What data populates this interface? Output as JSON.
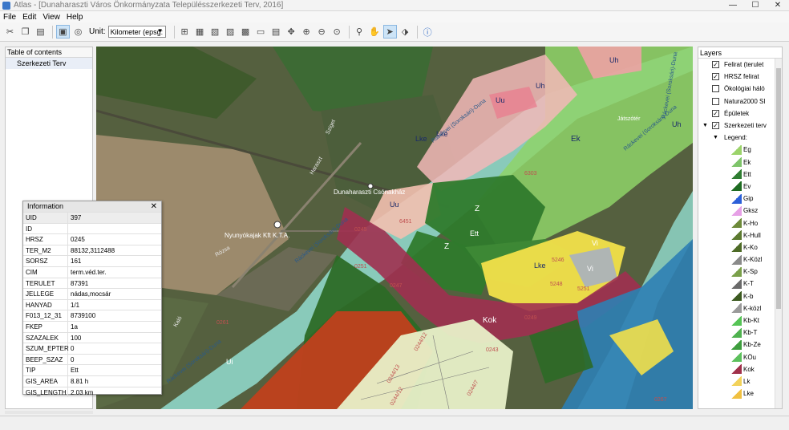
{
  "window": {
    "title": "Atlas - [Dunaharaszti Város Önkormányzata Településszerkezeti Terv, 2016]",
    "minimize": "—",
    "maximize": "☐",
    "close": "✕"
  },
  "menu": [
    "File",
    "Edit",
    "View",
    "Help"
  ],
  "toolbar": {
    "unit_label": "Unit:",
    "unit_value": "Kilometer (epsg:"
  },
  "toc": {
    "header": "Table of contents",
    "items": [
      "Szerkezeti Terv"
    ]
  },
  "layers": {
    "header": "Layers",
    "items": [
      {
        "label": "Felirat (terulet",
        "checked": true
      },
      {
        "label": "HRSZ felirat",
        "checked": true
      },
      {
        "label": "Ökológiai háló",
        "checked": false
      },
      {
        "label": "Natura2000 SI",
        "checked": false
      },
      {
        "label": "Épületek",
        "checked": true
      },
      {
        "label": "Szerkezeti terv",
        "checked": true
      }
    ],
    "legend_label": "Legend:",
    "legend": [
      {
        "label": "Eg",
        "color": "#9bd36a"
      },
      {
        "label": "Ek",
        "color": "#7ec46a"
      },
      {
        "label": "Ett",
        "color": "#2f7d32"
      },
      {
        "label": "Ev",
        "color": "#1e6b21"
      },
      {
        "label": "Gip",
        "color": "#2b5fd8"
      },
      {
        "label": "Gksz",
        "color": "#e6a0e6"
      },
      {
        "label": "K-Ho",
        "color": "#6d8a3a"
      },
      {
        "label": "K-Hull",
        "color": "#5c7a30"
      },
      {
        "label": "K-Ko",
        "color": "#4e6b27"
      },
      {
        "label": "K-Közl",
        "color": "#8a8a8a"
      },
      {
        "label": "K-Sp",
        "color": "#7aa04a"
      },
      {
        "label": "K-T",
        "color": "#6a6a6a"
      },
      {
        "label": "K-b",
        "color": "#3c5a20"
      },
      {
        "label": "K-közl",
        "color": "#9a9a9a"
      },
      {
        "label": "Kb-Kt",
        "color": "#55c455"
      },
      {
        "label": "Kb-T",
        "color": "#4fb24f"
      },
      {
        "label": "Kb-Ze",
        "color": "#3e9e3e"
      },
      {
        "label": "KÖu",
        "color": "#5cc05c"
      },
      {
        "label": "Kok",
        "color": "#a0304a"
      },
      {
        "label": "Lk",
        "color": "#f2d25a"
      },
      {
        "label": "Lke",
        "color": "#f0c040"
      }
    ]
  },
  "info": {
    "title": "Information",
    "close": "✕",
    "rows": [
      {
        "key": "UID",
        "value": "397"
      },
      {
        "key": "ID",
        "value": ""
      },
      {
        "key": "HRSZ",
        "value": "0245"
      },
      {
        "key": "TER_M2",
        "value": "88132,3112488"
      },
      {
        "key": "SORSZ",
        "value": "161"
      },
      {
        "key": "CIM",
        "value": "term.véd.ter."
      },
      {
        "key": "TERULET",
        "value": "87391"
      },
      {
        "key": "JELLEGE",
        "value": "nádas,mocsár"
      },
      {
        "key": "HANYAD",
        "value": "1/1"
      },
      {
        "key": "F013_12_31",
        "value": "8739100"
      },
      {
        "key": "FKEP",
        "value": "1a"
      },
      {
        "key": "SZAZALEK",
        "value": "100"
      },
      {
        "key": "SZUM_EPTER",
        "value": "0"
      },
      {
        "key": "BEEP_SZAZ",
        "value": "0"
      },
      {
        "key": "TIP",
        "value": "Ett"
      },
      {
        "key": "GIS_AREA",
        "value": "8.81 h"
      },
      {
        "key": "GIS_LENGTH",
        "value": "2.03 km"
      }
    ]
  },
  "map": {
    "labels": {
      "ek": "Ek",
      "z1": "Z",
      "z2": "Z",
      "ett": "Ett",
      "lke1": "Lke",
      "lke2": "Lke",
      "lke3": "Lke",
      "uu1": "Uu",
      "uu2": "Uu",
      "uh1": "Uh",
      "uh2": "Uh",
      "uh3": "Uh",
      "vi1": "Vi",
      "vi2": "Vi",
      "kok": "Kok",
      "ui": "Ui",
      "poi1": "Dunaharaszti Csónakház",
      "poi2": "Nyunyókajak Kft K.T.A.",
      "poi3": "Játszótér",
      "street1": "Ráckevei (Soroksári)-Duna",
      "street2": "Ráckevei (Soroksári)-Duna",
      "street3": "Ráckevei (Soroksári)-Duna",
      "street4": "Ráckevei (Soroksári)-Duna",
      "street5": "Rózsa",
      "street6": "Ráckevei (Soroksári)-Duna",
      "street7": "Haraszt",
      "street8": "Kaló",
      "street9": "Sziget",
      "p1": "0245",
      "p2": "0247",
      "p3": "0249",
      "p4": "0251",
      "p5": "0244/12",
      "p6": "0244/12",
      "p7": "0244/7",
      "p8": "0244/13",
      "p9": "0243",
      "p10": "6303",
      "p11": "6451",
      "p12": "5246",
      "p13": "5248",
      "p14": "5251",
      "p15": "0261",
      "p16": "0267"
    }
  }
}
